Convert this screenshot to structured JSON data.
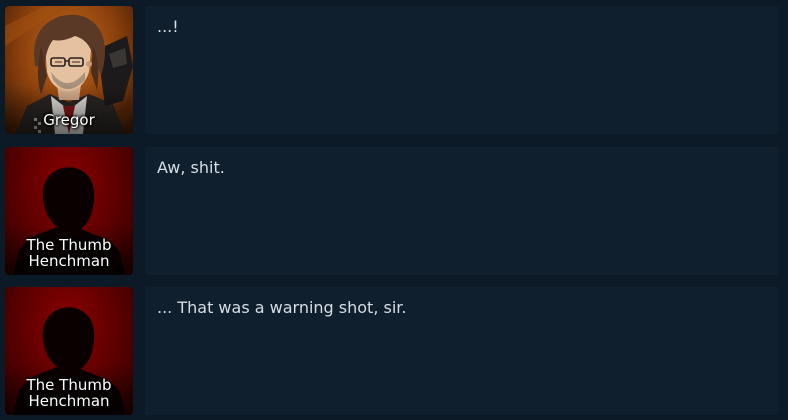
{
  "log": {
    "entries": [
      {
        "speaker": [
          "Gregor"
        ],
        "text": "...!"
      },
      {
        "speaker": [
          "The Thumb",
          "Henchman"
        ],
        "text": "Aw, shit."
      },
      {
        "speaker": [
          "The Thumb",
          "Henchman"
        ],
        "text": "... That was a warning shot, sir."
      }
    ]
  },
  "colors": {
    "background": "#0c1a28",
    "bubble": "#0f1f2e",
    "text": "#d7dde3",
    "gregor_bg": "#c46a1c",
    "henchman_bg": "#8a0000"
  },
  "icons": {
    "gregor_portrait": "gregor-portrait",
    "henchman_portrait": "silhouette-portrait"
  }
}
